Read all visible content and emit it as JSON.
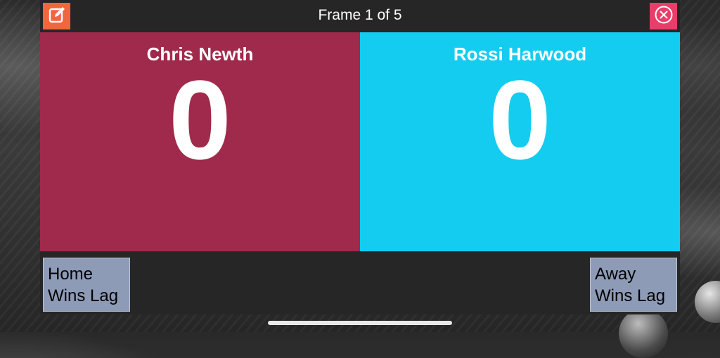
{
  "header": {
    "title": "Frame 1 of 5",
    "edit_icon": "edit-icon",
    "close_icon": "close-icon"
  },
  "players": {
    "home": {
      "name": "Chris Newth",
      "score": "0",
      "color": "#a02a4b"
    },
    "away": {
      "name": "Rossi Harwood",
      "score": "0",
      "color": "#14ccf0"
    }
  },
  "lag": {
    "home_line1": "Home",
    "home_line2": "Wins Lag",
    "away_line1": "Away",
    "away_line2": "Wins Lag"
  },
  "colors": {
    "edit_button": "#f2663d",
    "close_button": "#ea3d6a",
    "lag_button": "#8e9bb7",
    "panel": "#262626"
  }
}
